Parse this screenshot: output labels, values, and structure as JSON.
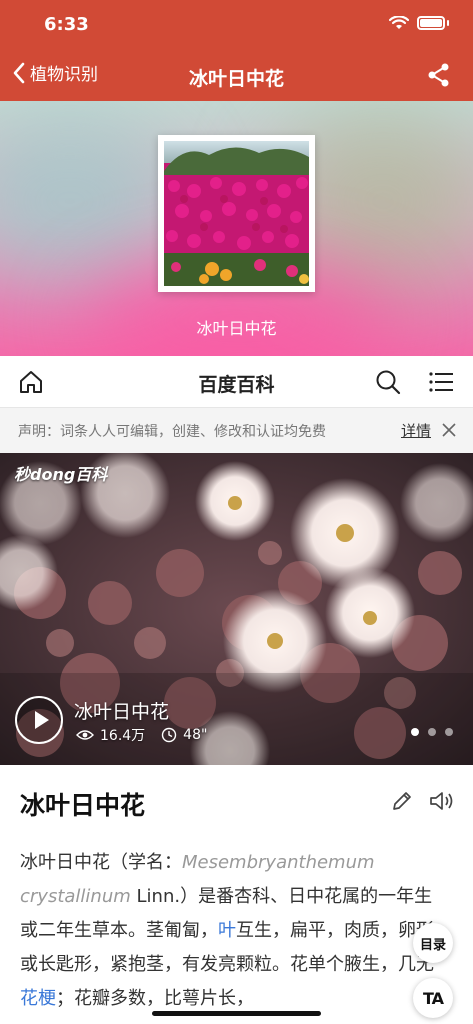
{
  "status_bar": {
    "time": "6:33"
  },
  "nav": {
    "back_label": "植物识别",
    "title": "冰叶日中花"
  },
  "hero": {
    "caption": "冰叶日中花"
  },
  "baike": {
    "title": "百度百科"
  },
  "notice": {
    "text": "声明：词条人人可编辑，创建、修改和认证均免费",
    "link": "详情"
  },
  "video": {
    "logo": "秒dong百科",
    "title": "冰叶日中花",
    "views": "16.4万",
    "duration": "48\""
  },
  "article": {
    "title": "冰叶日中花",
    "p1_a": "冰叶日中花（学名：",
    "p1_latin1": "Mesembryanthemum crystallinum",
    "p1_b": " Linn.）是番杏科、日中花属的一年生或二年生草本。茎匍匐，",
    "p1_link1": "叶",
    "p1_c": "互生，扁平，肉质，卵形或长匙形，紧抱茎，有发亮颗粒。花单个腋生，几无",
    "p1_link2": "花梗",
    "p1_d": "；花瓣多数，比萼片长，"
  },
  "floating": {
    "toc": "目录",
    "font": "TA"
  },
  "colors": {
    "brand_red": "#d14a36",
    "link_blue": "#3a78d8"
  }
}
